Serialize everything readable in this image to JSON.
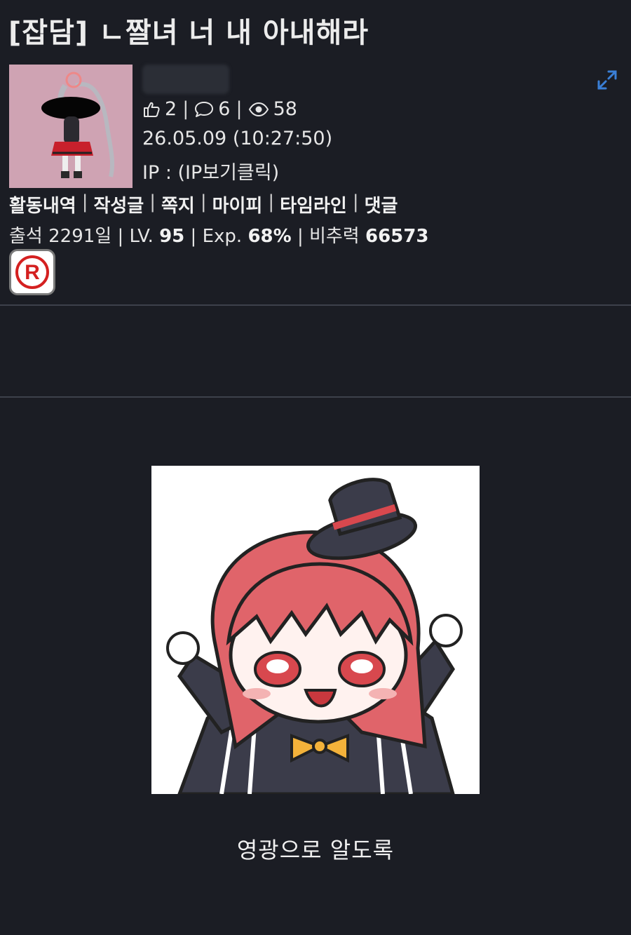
{
  "post": {
    "title": "[잡담] ㄴ짤녀 너 내 아내해라",
    "likes": "2",
    "comments": "6",
    "views": "58",
    "datetime": "26.05.09 (10:27:50)",
    "ip_label": "IP : ",
    "ip_link": "(IP보기클릭)",
    "caption": "영광으로 알도록"
  },
  "user_links": [
    "활동내역",
    "작성글",
    "쪽지",
    "마이피",
    "타임라인",
    "댓글"
  ],
  "user_stats": {
    "attendance_label": "출석 ",
    "attendance_value": "2291일",
    "level_label": "LV. ",
    "level_value": "95",
    "exp_label": "Exp. ",
    "exp_value": "68%",
    "unrecommend_label": "비추력 ",
    "unrecommend_value": "66573"
  },
  "badge": {
    "letter": "R",
    "color": "#d42020"
  },
  "colors": {
    "background": "#1b1d24",
    "expand_icon": "#3a7fd6",
    "profile_bg": "#cfa3b3",
    "hair_red": "#e0646a"
  },
  "icons": [
    "thumbs-up-icon",
    "comment-icon",
    "eye-icon",
    "expand-icon",
    "registered-badge-icon"
  ]
}
